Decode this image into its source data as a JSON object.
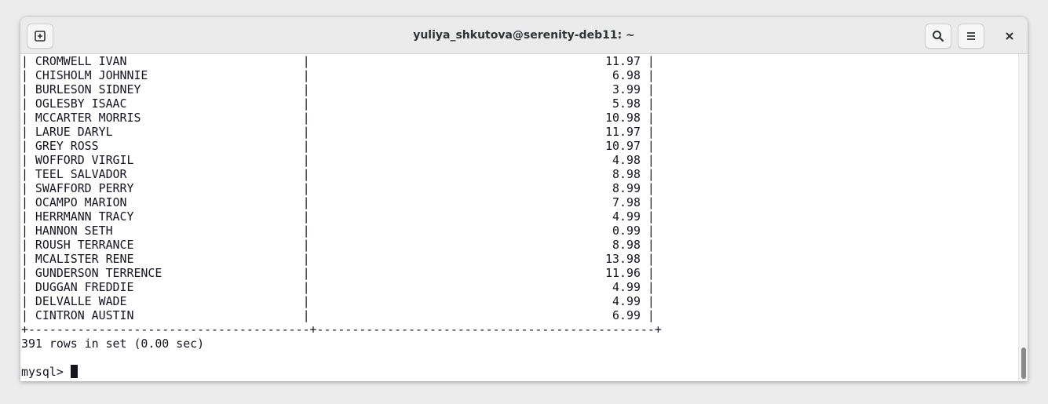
{
  "window": {
    "title": "yuliya_shkutova@serenity-deb11: ~"
  },
  "header_buttons": {
    "new_tab_icon": "new-tab-icon",
    "search_icon": "search-icon",
    "menu_icon": "hamburger-menu-icon",
    "close_icon": "close-icon"
  },
  "table": {
    "rows": [
      {
        "name": "CROMWELL IVAN",
        "amount": "11.97"
      },
      {
        "name": "CHISHOLM JOHNNIE",
        "amount": "6.98"
      },
      {
        "name": "BURLESON SIDNEY",
        "amount": "3.99"
      },
      {
        "name": "OGLESBY ISAAC",
        "amount": "5.98"
      },
      {
        "name": "MCCARTER MORRIS",
        "amount": "10.98"
      },
      {
        "name": "LARUE DARYL",
        "amount": "11.97"
      },
      {
        "name": "GREY ROSS",
        "amount": "10.97"
      },
      {
        "name": "WOFFORD VIRGIL",
        "amount": "4.98"
      },
      {
        "name": "TEEL SALVADOR",
        "amount": "8.98"
      },
      {
        "name": "SWAFFORD PERRY",
        "amount": "8.99"
      },
      {
        "name": "OCAMPO MARION",
        "amount": "7.98"
      },
      {
        "name": "HERRMANN TRACY",
        "amount": "4.99"
      },
      {
        "name": "HANNON SETH",
        "amount": "0.99"
      },
      {
        "name": "ROUSH TERRANCE",
        "amount": "8.98"
      },
      {
        "name": "MCALISTER RENE",
        "amount": "13.98"
      },
      {
        "name": "GUNDERSON TERRENCE",
        "amount": "11.96"
      },
      {
        "name": "DUGGAN FREDDIE",
        "amount": "4.99"
      },
      {
        "name": "DELVALLE WADE",
        "amount": "4.99"
      },
      {
        "name": "CINTRON AUSTIN",
        "amount": "6.99"
      }
    ]
  },
  "result_summary": "391 rows in set (0.00 sec)",
  "prompt": "mysql> "
}
